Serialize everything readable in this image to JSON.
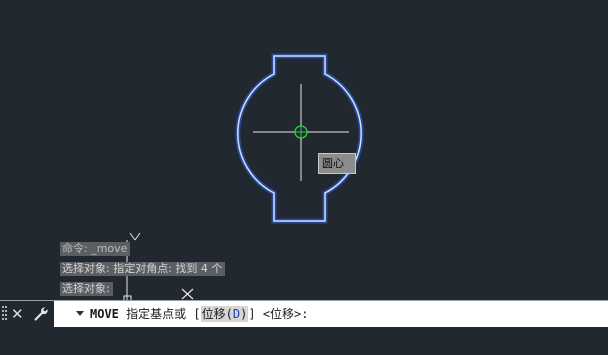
{
  "drawing": {
    "tooltip_label": "圆心"
  },
  "command_history": [
    "命令: _move",
    "选择对象: 指定对角点: 找到 4 个",
    "选择对象:"
  ],
  "command_line": {
    "command_name": "MOVE",
    "prompt_text": "指定基点或",
    "open_bracket": "[",
    "option_label": "位移",
    "option_hotkey_open": "(",
    "option_hotkey": "D",
    "option_hotkey_close": ")",
    "close_bracket": "]",
    "default_value": "<位移>:"
  },
  "icons": {
    "grip": "grip-handle-icon",
    "close": "close-icon",
    "customize": "wrench-icon",
    "recent_commands": "dropdown-arrow-icon"
  },
  "colors": {
    "background": "#212830",
    "highlight_glow": "#4f8bff",
    "osnap_marker": "#2bd43b",
    "crosshair": "#e6e6e6"
  }
}
